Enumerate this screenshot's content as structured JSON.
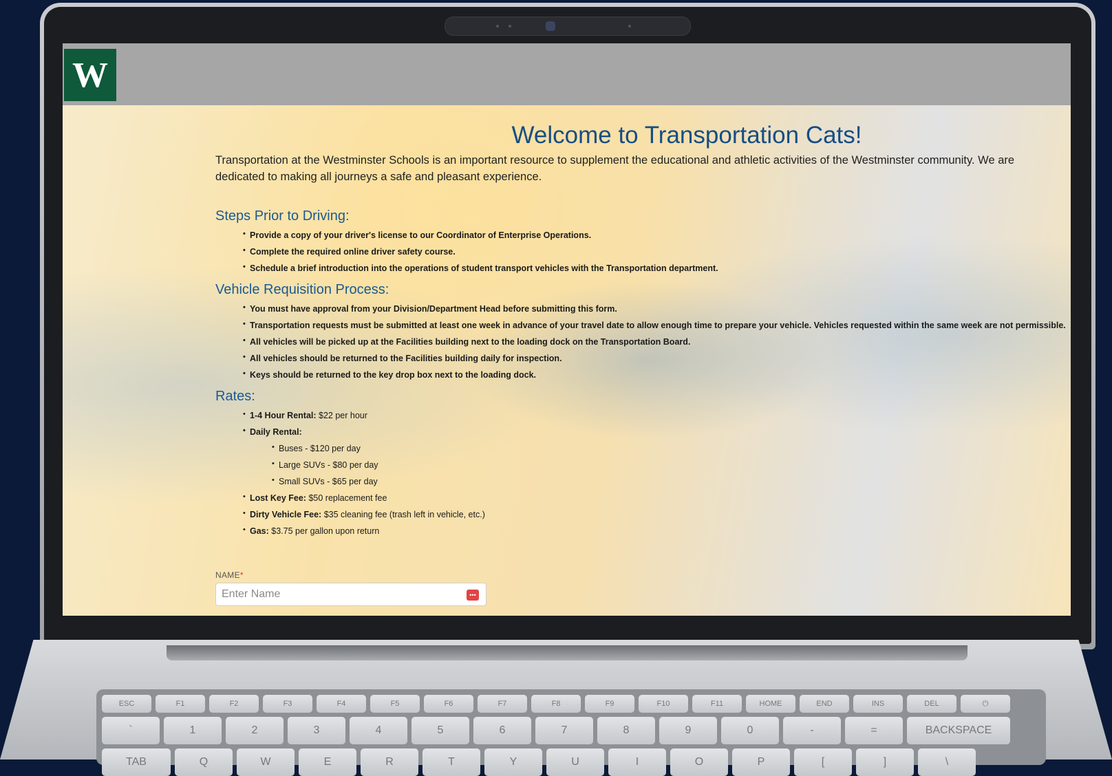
{
  "page": {
    "title": "Welcome to Transportation Cats!",
    "intro": "Transportation at the Westminster Schools is an important resource to supplement the educational and athletic activities of the Westminster community. We are dedicated to making all journeys a safe and pleasant experience."
  },
  "header": {
    "logo_letter": "W",
    "logo_color": "#0e5a3b",
    "bar_color": "#a6a6a6"
  },
  "steps": {
    "heading": "Steps Prior to Driving:",
    "items": [
      "Provide a copy of your driver's license to our Coordinator of Enterprise Operations.",
      "Complete the required online driver safety course.",
      "Schedule a brief introduction into the operations of student transport vehicles with the Transportation department."
    ]
  },
  "vehicle": {
    "heading": "Vehicle Requisition Process:",
    "items": [
      "You must have approval from your Division/Department Head before submitting this form.",
      "Transportation requests must be submitted at least one week in advance of your travel date to allow enough time to prepare your vehicle. Vehicles requested within the same week are not permissible.",
      "All vehicles will be picked up at the Facilities building next to the loading dock on the Transportation Board.",
      "All vehicles should be returned to the Facilities building daily for inspection.",
      "Keys should be returned to the key drop box next to the loading dock."
    ]
  },
  "rates": {
    "heading": "Rates:",
    "hourly": {
      "label": "1-4 Hour Rental:",
      "value": "$22 per hour"
    },
    "daily": {
      "label": "Daily Rental:",
      "items": [
        "Buses - $120 per day",
        "Large SUVs - $80 per day",
        "Small SUVs - $65 per day"
      ]
    },
    "lost_key": {
      "label": "Lost Key Fee:",
      "value": "$50 replacement fee"
    },
    "dirty": {
      "label": "Dirty Vehicle Fee:",
      "value": "$35 cleaning fee (trash left in vehicle, etc.)"
    },
    "gas": {
      "label": "Gas:",
      "value": "$3.75 per gallon upon return"
    }
  },
  "form": {
    "name_label": "NAME",
    "required_mark": "*",
    "name_placeholder": "Enter Name",
    "name_value": "",
    "field_icon": "more-dots-icon"
  },
  "keyboard": {
    "fn_row": [
      "ESC",
      "F1",
      "F2",
      "F3",
      "F4",
      "F5",
      "F6",
      "F7",
      "F8",
      "F9",
      "F10",
      "F11",
      "HOME",
      "END",
      "INS",
      "DEL",
      "⏻"
    ],
    "num_row": [
      "`",
      "1",
      "2",
      "3",
      "4",
      "5",
      "6",
      "7",
      "8",
      "9",
      "0",
      "-",
      "=",
      "BACKSPACE"
    ],
    "top_row": [
      "TAB",
      "Q",
      "W",
      "E",
      "R",
      "T",
      "Y",
      "U",
      "I",
      "O",
      "P",
      "[",
      "]",
      "\\"
    ]
  },
  "colors": {
    "heading_blue": "#154e85",
    "background": "#0b1a38"
  }
}
